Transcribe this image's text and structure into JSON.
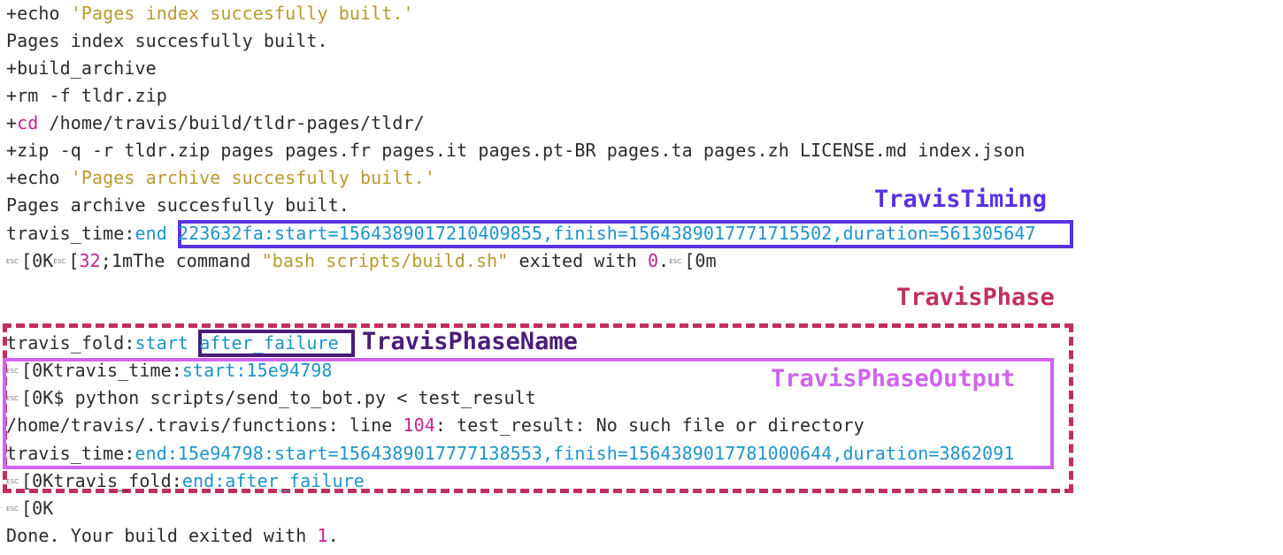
{
  "esc_glyph": "ESC",
  "log": {
    "l1": {
      "prefix": "+echo ",
      "str": "'Pages index succesfully built.'"
    },
    "l2": "Pages index succesfully built.",
    "l3": "+build_archive",
    "l4": "+rm -f tldr.zip",
    "l5": {
      "plus": "+",
      "cmd": "cd",
      "rest": " /home/travis/build/tldr-pages/tldr/"
    },
    "l6": "+zip -q -r tldr.zip pages pages.fr pages.it pages.pt-BR pages.ta pages.zh LICENSE.md index.json",
    "l7": {
      "prefix": "+echo ",
      "str": "'Pages archive succesfully built.'"
    },
    "l8": "Pages archive succesfully built.",
    "l9": {
      "key": "travis_time:",
      "kw": "end",
      "sp": " ",
      "val": "223632fa:start=1564389017210409855,finish=1564389017771715502,duration=561305647"
    },
    "l10": {
      "a": "[0K",
      "b": "[",
      "code": "32",
      "c": ";1mThe command ",
      "str": "\"bash scripts/build.sh\"",
      "d": " exited with ",
      "num": "0",
      "e": ".",
      "f": "[0m"
    },
    "l11": {
      "key": "travis_fold:",
      "kw": "start",
      "sp": " ",
      "val": "after_failure"
    },
    "l12": {
      "a": "[0Ktravis_time:",
      "val": "start:15e94798"
    },
    "l13": {
      "a": "[0K$ python scripts/send_to_bot.py < test_result"
    },
    "l14": {
      "a": "/home/travis/.travis/functions: line ",
      "num": "104",
      "b": ": test_result: No such file or directory"
    },
    "l15": {
      "key": "travis_time:",
      "val": "end:15e94798:start=1564389017777138553,finish=1564389017781000644,duration=3862091"
    },
    "l16": {
      "a": "[0Ktravis_fold:",
      "val": "end:after_failure"
    },
    "l17": {
      "a": "[0K"
    },
    "l18": {
      "a": "Done. Your build exited with ",
      "num": "1",
      "b": "."
    }
  },
  "labels": {
    "timing": "TravisTiming",
    "phase": "TravisPhase",
    "phase_name": "TravisPhaseName",
    "phase_output": "TravisPhaseOutput"
  },
  "colors": {
    "string": "#b99a2e",
    "keyword": "#c7248e",
    "value": "#1f93c9",
    "timing": "#5a32e0",
    "phase": "#c0305f",
    "phase_name": "#4a1d78",
    "phase_output": "#d064ee"
  }
}
